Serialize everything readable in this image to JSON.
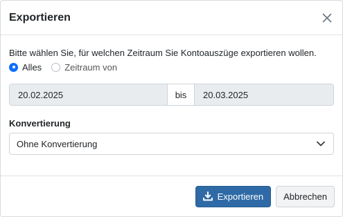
{
  "dialog": {
    "title": "Exportieren",
    "close_icon": "close-icon"
  },
  "period": {
    "instruction": "Bitte wählen Sie, für welchen Zeitraum Sie Kontoauszüge exportieren wollen.",
    "options": [
      {
        "label": "Alles",
        "selected": true
      },
      {
        "label": "Zeitraum von",
        "selected": false
      }
    ],
    "date_from": "20.02.2025",
    "separator": "bis",
    "date_to": "20.03.2025"
  },
  "conversion": {
    "label": "Konvertierung",
    "selected": "Ohne Konvertierung",
    "icon": "chevron-down-icon"
  },
  "footer": {
    "export_label": "Exportieren",
    "export_icon": "download-icon",
    "cancel_label": "Abbrechen"
  },
  "colors": {
    "primary": "#2f6aa6",
    "radio_checked": "#0d6efd",
    "disabled_bg": "#e9ecef"
  }
}
